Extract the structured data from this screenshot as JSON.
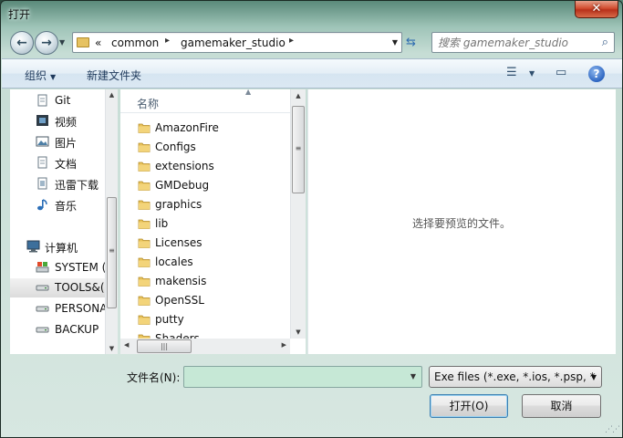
{
  "window": {
    "title": "打开",
    "close_label": "✕"
  },
  "address": {
    "overflow_marker": "«",
    "crumbs": [
      "common",
      "gamemaker_studio"
    ],
    "separator": "▸"
  },
  "search": {
    "placeholder": "搜索 gamemaker_studio"
  },
  "toolbar": {
    "organize_label": "组织",
    "new_folder_label": "新建文件夹"
  },
  "nav": {
    "items": [
      {
        "label": "Git",
        "icon": "document-icon"
      },
      {
        "label": "视频",
        "icon": "video-icon"
      },
      {
        "label": "图片",
        "icon": "picture-icon"
      },
      {
        "label": "文档",
        "icon": "document-icon"
      },
      {
        "label": "迅雷下载",
        "icon": "download-folder-icon"
      },
      {
        "label": "音乐",
        "icon": "music-icon"
      },
      {
        "label": "计算机",
        "icon": "computer-icon"
      },
      {
        "label": "SYSTEM (",
        "icon": "system-drive-icon"
      },
      {
        "label": "TOOLS&(",
        "icon": "drive-icon"
      },
      {
        "label": "PERSONA",
        "icon": "drive-icon"
      },
      {
        "label": "BACKUP",
        "icon": "drive-icon"
      }
    ]
  },
  "files": {
    "column_name": "名称",
    "items": [
      "AmazonFire",
      "Configs",
      "extensions",
      "GMDebug",
      "graphics",
      "lib",
      "Licenses",
      "locales",
      "makensis",
      "OpenSSL",
      "putty",
      "Shaders"
    ]
  },
  "preview": {
    "empty_text": "选择要预览的文件。"
  },
  "bottom": {
    "filename_label": "文件名(N):",
    "filename_value": "",
    "filetype_value": "Exe files (*.exe, *.ios, *.psp, *",
    "open_label": "打开(O)",
    "cancel_label": "取消"
  }
}
